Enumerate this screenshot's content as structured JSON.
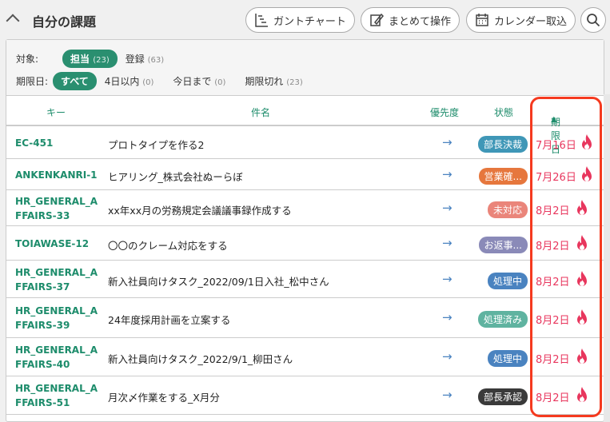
{
  "header": {
    "title": "自分の課題",
    "buttons": {
      "gantt": "ガントチャート",
      "bulk": "まとめて操作",
      "calendar": "カレンダー取込"
    }
  },
  "filters": {
    "target_label": "対象:",
    "target": [
      {
        "label": "担当",
        "count": "(23)",
        "active": true
      },
      {
        "label": "登録",
        "count": "(63)",
        "active": false
      }
    ],
    "due_label": "期限日:",
    "due": [
      {
        "label": "すべて",
        "count": "",
        "active": true
      },
      {
        "label": "4日以内",
        "count": "(0)"
      },
      {
        "label": "今日まで",
        "count": "(0)"
      },
      {
        "label": "期限切れ",
        "count": "(23)"
      }
    ]
  },
  "columns": {
    "key": "キー",
    "subject": "件名",
    "priority": "優先度",
    "status": "状態",
    "due": "期限日"
  },
  "rows": [
    {
      "key": "EC-451",
      "subject": "プロトタイプを作る2",
      "priority": "→",
      "status": "部長決裁",
      "color": "#3f97b7",
      "due": "7月16日"
    },
    {
      "key": "ANKENKANRI-1",
      "subject": "ヒアリング_株式会社ぬーらぼ",
      "priority": "→",
      "status": "営業確...",
      "color": "#e6773d",
      "due": "7月26日"
    },
    {
      "key": "HR_GENERAL_AFFAIRS-33",
      "subject": "xx年xx月の労務規定会議議事録作成する",
      "priority": "→",
      "status": "未対応",
      "color": "#ea857a",
      "due": "8月2日"
    },
    {
      "key": "TOIAWASE-12",
      "subject": "〇〇のクレーム対応をする",
      "priority": "→",
      "status": "お返事...",
      "color": "#8a8ab8",
      "due": "8月2日"
    },
    {
      "key": "HR_GENERAL_AFFAIRS-37",
      "subject": "新入社員向けタスク_2022/09/1日入社_松中さん",
      "priority": "→",
      "status": "処理中",
      "color": "#4a83c0",
      "due": "8月2日"
    },
    {
      "key": "HR_GENERAL_AFFAIRS-39",
      "subject": "24年度採用計画を立案する",
      "priority": "→",
      "status": "処理済み",
      "color": "#5fb3a0",
      "due": "8月2日"
    },
    {
      "key": "HR_GENERAL_AFFAIRS-40",
      "subject": "新入社員向けタスク_2022/9/1_柳田さん",
      "priority": "→",
      "status": "処理中",
      "color": "#4a83c0",
      "due": "8月2日"
    },
    {
      "key": "HR_GENERAL_AFFAIRS-51",
      "subject": "月次〆作業をする_X月分",
      "priority": "→",
      "status": "部長承認",
      "color": "#3a3a3a",
      "due": "8月2日"
    }
  ]
}
